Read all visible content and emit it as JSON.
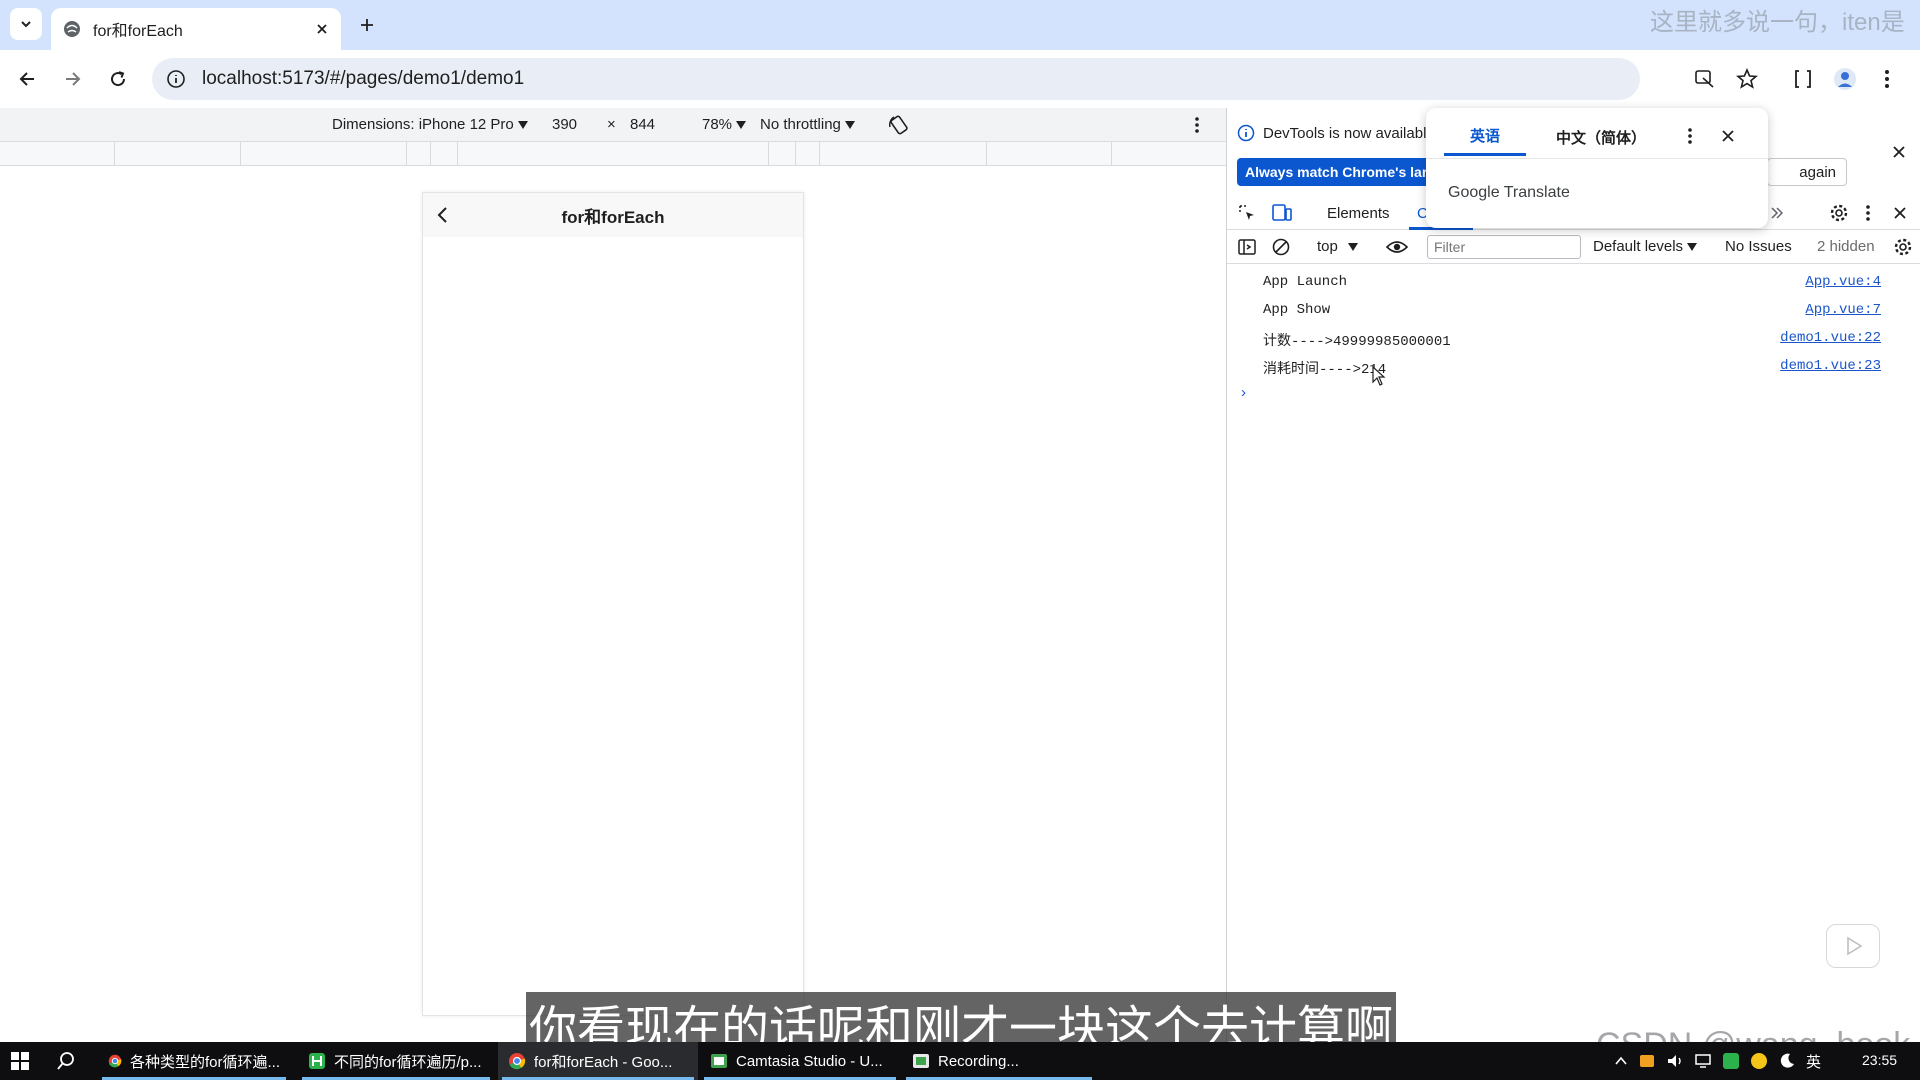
{
  "browser": {
    "tab": {
      "title": "for和forEach"
    },
    "overlay_text": "这里就多说一句，iten是",
    "address": "localhost:5173/#/pages/demo1/demo1"
  },
  "device_toolbar": {
    "dimensions_label": "Dimensions: iPhone 12 Pro",
    "width": "390",
    "times": "×",
    "height": "844",
    "zoom": "78%",
    "throttling": "No throttling"
  },
  "device": {
    "nav_title": "for和forEach"
  },
  "devtools": {
    "info_text": "DevTools is now availabl",
    "info_button": "Always match Chrome's lar",
    "dontshow_button": "again",
    "tabs": {
      "elements": "Elements",
      "console_partial": "C"
    },
    "console": {
      "context": "top",
      "filter_placeholder": "Filter",
      "levels": "Default levels",
      "issues": "No Issues",
      "hidden": "2 hidden",
      "lines": [
        {
          "message": "App Launch",
          "source": "App.vue:4"
        },
        {
          "message": "App Show",
          "source": "App.vue:7"
        },
        {
          "message": "计数---->49999985000001",
          "source": "demo1.vue:22"
        },
        {
          "message": "消耗时间---->214",
          "source": "demo1.vue:23"
        }
      ],
      "prompt": "›"
    }
  },
  "translate_popup": {
    "tab_source": "英语",
    "tab_target": "中文（简体）",
    "brand": "Google Translate"
  },
  "subtitle": "你看现在的话呢和刚才一块这个去计算啊",
  "watermark": "CSDN @wang_book",
  "taskbar": {
    "items": [
      {
        "label": "各种类型的for循环遍..."
      },
      {
        "label": "不同的for循环遍历/p..."
      },
      {
        "label": "for和forEach - Goo..."
      },
      {
        "label": "Camtasia Studio - U..."
      },
      {
        "label": "Recording..."
      }
    ],
    "ime": "英",
    "time": "23:55"
  },
  "colors": {
    "tabstrip": "#d3e3fd",
    "accent_blue": "#0b57d0",
    "link_blue": "#1a56c9",
    "taskbar": "#0e0e10"
  }
}
